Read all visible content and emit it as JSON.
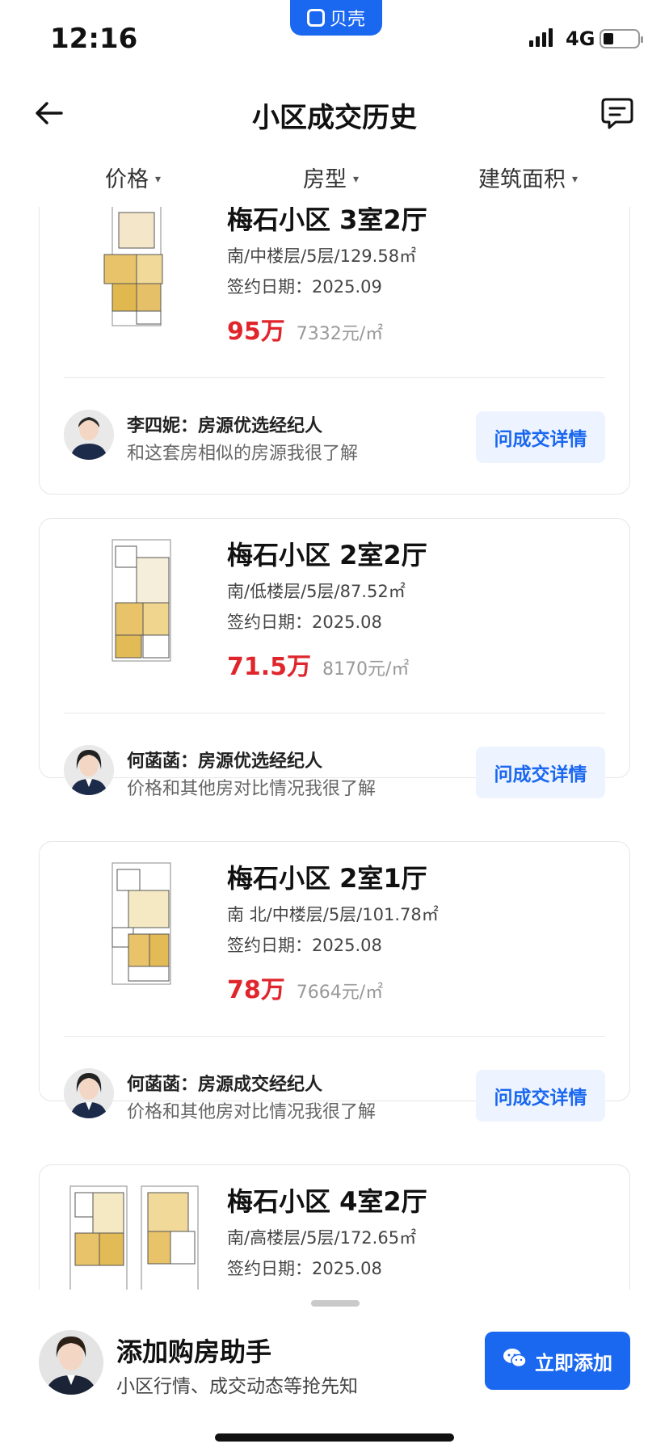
{
  "status_bar": {
    "time": "12:16",
    "app_name": "贝壳",
    "network": "4G"
  },
  "header": {
    "title": "小区成交历史"
  },
  "filters": [
    {
      "label": "价格"
    },
    {
      "label": "房型"
    },
    {
      "label": "建筑面积"
    }
  ],
  "listings": [
    {
      "title": "梅石小区 3室2厅",
      "desc": "南/中楼层/5层/129.58㎡",
      "date": "签约日期：2025.09",
      "price": "95万",
      "unit_price": "7332元/㎡",
      "agent_name": "李四妮：房源优选经纪人",
      "agent_slogan": "和这套房相似的房源我很了解",
      "button": "问成交详情"
    },
    {
      "title": "梅石小区 2室2厅",
      "desc": "南/低楼层/5层/87.52㎡",
      "date": "签约日期：2025.08",
      "price": "71.5万",
      "unit_price": "8170元/㎡",
      "agent_name": "何菡菡：房源优选经纪人",
      "agent_slogan": "价格和其他房对比情况我很了解",
      "button": "问成交详情"
    },
    {
      "title": "梅石小区 2室1厅",
      "desc": "南 北/中楼层/5层/101.78㎡",
      "date": "签约日期：2025.08",
      "price": "78万",
      "unit_price": "7664元/㎡",
      "agent_name": "何菡菡：房源成交经纪人",
      "agent_slogan": "价格和其他房对比情况我很了解",
      "button": "问成交详情"
    },
    {
      "title": "梅石小区 4室2厅",
      "desc": "南/高楼层/5层/172.65㎡",
      "date": "签约日期：2025.08"
    }
  ],
  "bottom": {
    "title": "添加购房助手",
    "subtitle": "小区行情、成交动态等抢先知",
    "button": "立即添加"
  },
  "colors": {
    "accent": "#1a67f0",
    "price": "#e0262d",
    "button_bg": "#eef4ff"
  }
}
